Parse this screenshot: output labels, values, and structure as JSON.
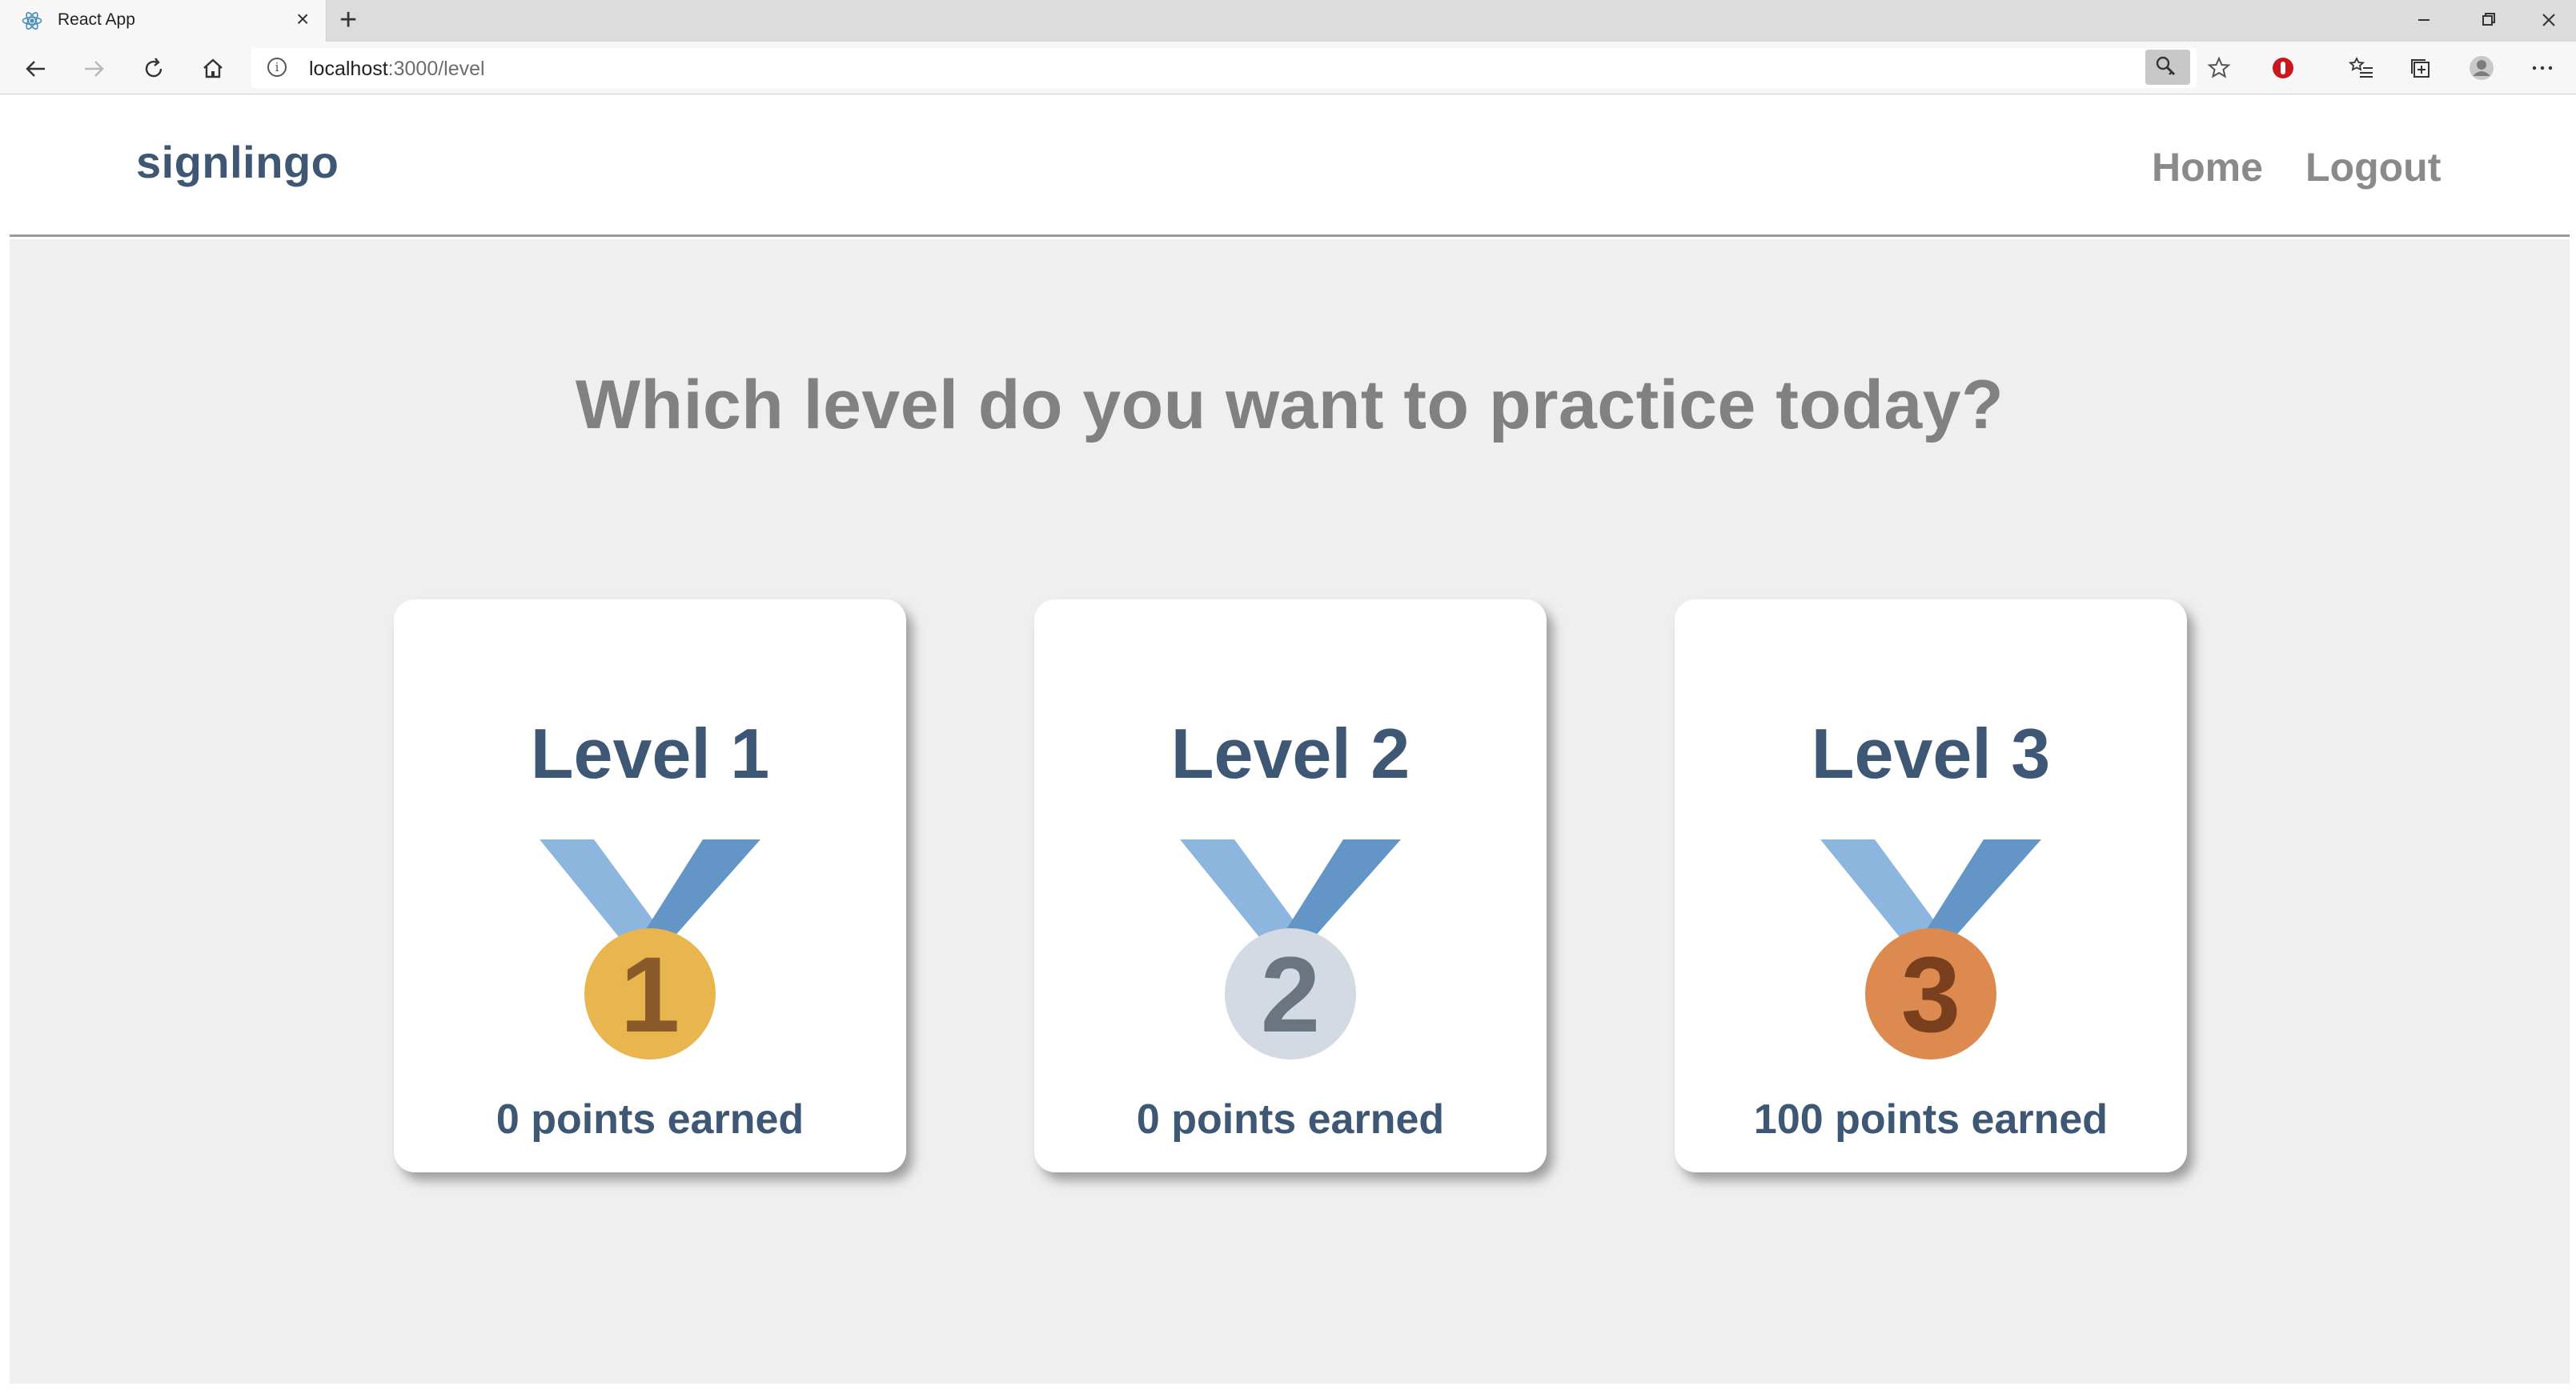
{
  "browser": {
    "tab_title": "React App",
    "url_host": "localhost",
    "url_path": ":3000/level"
  },
  "app": {
    "brand": "signlingo",
    "nav": {
      "home": "Home",
      "logout": "Logout"
    },
    "question": "Which level do you want to practice today?",
    "levels": [
      {
        "title": "Level 1",
        "medal_number": "1",
        "points": "0 points earned",
        "medal_color": "#e8b54f",
        "number_color": "#8b5a2b"
      },
      {
        "title": "Level 2",
        "medal_number": "2",
        "points": "0 points earned",
        "medal_color": "#d3dae3",
        "number_color": "#6b7580"
      },
      {
        "title": "Level 3",
        "medal_number": "3",
        "points": "100 points earned",
        "medal_color": "#dd8a50",
        "number_color": "#7a3f1d"
      }
    ]
  },
  "colors": {
    "brand": "#3e5775",
    "nav_text": "#8a8a8a",
    "ribbon_light": "#8cb6de",
    "ribbon_dark": "#6396c7"
  }
}
